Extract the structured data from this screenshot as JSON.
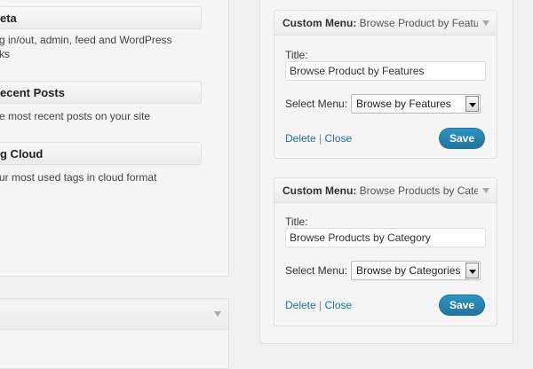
{
  "available_widgets": [
    {
      "title": "eta",
      "description_lines": [
        "g in/out, admin, feed and WordPress",
        "ks"
      ]
    },
    {
      "title": "ecent Posts",
      "description_lines": [
        "e most recent posts on your site"
      ]
    },
    {
      "title": "g Cloud",
      "description_lines": [
        "ur most used tags in cloud format"
      ]
    }
  ],
  "sidebar_widgets": [
    {
      "type_label": "Custom Menu:",
      "in_title": "Browse Product by Features",
      "title_label": "Title:",
      "title_value": "Browse Product by Features",
      "select_label": "Select Menu:",
      "selected_menu": "Browse by Features",
      "delete_label": "Delete",
      "separator": "|",
      "close_label": "Close",
      "save_label": "Save"
    },
    {
      "type_label": "Custom Menu:",
      "in_title": "Browse Products by Category",
      "title_label": "Title:",
      "title_value": "Browse Products by Category",
      "select_label": "Select Menu:",
      "selected_menu": "Browse by Categories",
      "delete_label": "Delete",
      "separator": "|",
      "close_label": "Close",
      "save_label": "Save"
    }
  ],
  "colors": {
    "link": "#21759b",
    "save_button": "#21759b",
    "background": "#f1f1f1"
  },
  "icons": [
    "chevron-down-icon"
  ]
}
